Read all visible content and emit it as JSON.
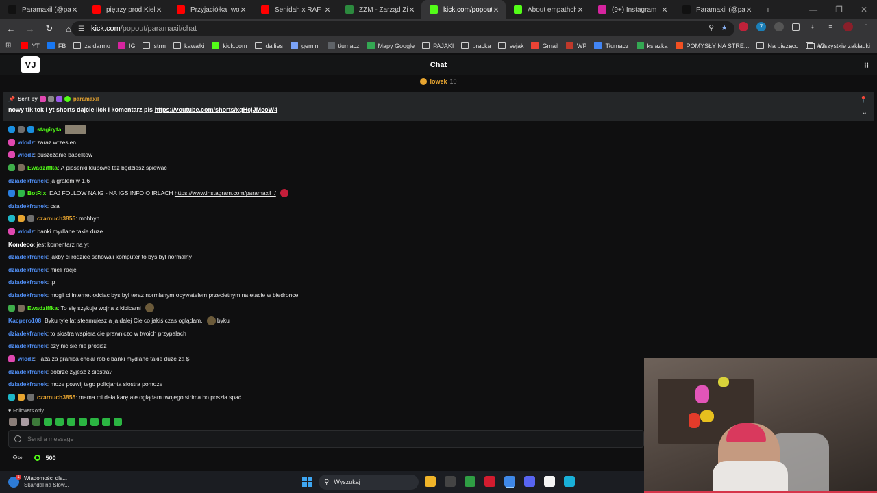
{
  "browser": {
    "tabs": [
      {
        "title": "Paramaxil (@paramaxil)",
        "favicon": "tiktok-icon",
        "color": "#111111"
      },
      {
        "title": "piętrzy prod.Kiełas - YouTube",
        "favicon": "youtube-icon",
        "color": "#ff0000"
      },
      {
        "title": "Przyjaciółka Iwony W",
        "favicon": "youtube-icon",
        "color": "#ff0000"
      },
      {
        "title": "Senidah x RAF Camora",
        "favicon": "youtube-icon",
        "color": "#ff0000"
      },
      {
        "title": "ZZM - Zarząd Zieleni",
        "favicon": "zzm-icon",
        "color": "#2c8a3e"
      },
      {
        "title": "kick.com/popout/paramaxil/chat",
        "favicon": "kick-icon",
        "color": "#53fc18",
        "active": true
      },
      {
        "title": "About empathchan -",
        "favicon": "kick-icon",
        "color": "#53fc18"
      },
      {
        "title": "(9+) Instagram",
        "favicon": "instagram-icon",
        "color": "#d6249f"
      },
      {
        "title": "Paramaxil (@paramaxil)",
        "favicon": "tiktok-icon",
        "color": "#111111"
      }
    ],
    "url_host": "kick.com",
    "url_path": "/popout/paramaxil/chat",
    "bookmarks": [
      {
        "label": "YT",
        "icon": "youtube-icon",
        "color": "#ff0000"
      },
      {
        "label": "FB",
        "icon": "facebook-icon",
        "color": "#1877f2"
      },
      {
        "label": "za darmo",
        "icon": "folder-icon"
      },
      {
        "label": "IG",
        "icon": "instagram-icon",
        "color": "#d6249f"
      },
      {
        "label": "strm",
        "icon": "folder-icon"
      },
      {
        "label": "kawałki",
        "icon": "folder-icon"
      },
      {
        "label": "kick.com",
        "icon": "kick-icon",
        "color": "#53fc18"
      },
      {
        "label": "dailies",
        "icon": "folder-icon"
      },
      {
        "label": "gemini",
        "icon": "gemini-icon",
        "color": "#7aa2f7"
      },
      {
        "label": "tłumacz",
        "icon": "translate-icon",
        "color": "#5f6368"
      },
      {
        "label": "Mapy Google",
        "icon": "maps-icon",
        "color": "#34a853"
      },
      {
        "label": "PAJĄKI",
        "icon": "folder-icon"
      },
      {
        "label": "pracka",
        "icon": "folder-icon"
      },
      {
        "label": "sejak",
        "icon": "folder-icon"
      },
      {
        "label": "Gmail",
        "icon": "gmail-icon",
        "color": "#ea4335"
      },
      {
        "label": "WP",
        "icon": "wp-icon",
        "color": "#c0392b"
      },
      {
        "label": "Tłumacz",
        "icon": "translate-icon",
        "color": "#4285f4"
      },
      {
        "label": "ksiazka",
        "icon": "book-icon",
        "color": "#34a853"
      },
      {
        "label": "POMYSŁY NA STRE...",
        "icon": "windows-icon",
        "color": "#f25022"
      },
      {
        "label": "Na bieżąco",
        "icon": "folder-icon"
      },
      {
        "label": "AD",
        "icon": "folder-icon"
      }
    ],
    "bookmarks_all": "Wszystkie zakładki",
    "more_bookmarks": "»"
  },
  "chat": {
    "header_title": "Chat",
    "logo_text": "VJ",
    "gift": {
      "name": "lowek",
      "count": "10"
    },
    "pinned": {
      "sent_by_label": "Sent by",
      "sender": "paramaxil",
      "message": "nowy tik tok i yt shorts dajcie lick i komentarz pls ",
      "link": "https://youtube.com/shorts/xqHcjJMeoW4"
    },
    "messages": [
      {
        "user": "stagiryta",
        "color": "#53fc18",
        "text": "",
        "badges": [
          "#1a8fe0",
          "#6f6f6f",
          "#1a8fe0"
        ],
        "emote": "wide"
      },
      {
        "user": "wlodz",
        "color": "#4f8cf0",
        "text": "zaraz wrzesien",
        "badges": [
          "#e048b0"
        ]
      },
      {
        "user": "wlodz",
        "color": "#4f8cf0",
        "text": "puszczanie babelkow",
        "badges": [
          "#e048b0"
        ]
      },
      {
        "user": "Ewadziffka",
        "color": "#53fc18",
        "text": "A piosenki klubowe też będziesz śpiewać",
        "badges": [
          "#3fae4a",
          "#7d6d5b"
        ]
      },
      {
        "user": "dziadekfranek",
        "color": "#4f8cf0",
        "text": "ja gralem w 1.6",
        "badges": []
      },
      {
        "user": "BotRix",
        "color": "#53fc18",
        "text": "DAJ FOLLOW NA IG - NA IGS INFO O IRLACH ",
        "link": "https://www.instagram.com/paramaxil_/",
        "badges": [
          "#2a7fe0",
          "#2fb84a"
        ],
        "emote": "red"
      },
      {
        "user": "dziadekfranek",
        "color": "#4f8cf0",
        "text": "csa",
        "badges": []
      },
      {
        "user": "czarnuch3855",
        "color": "#e8a530",
        "text": "mobbyn",
        "badges": [
          "#1fb8c8",
          "#e8a530",
          "#6f6f6f"
        ]
      },
      {
        "user": "wlodz",
        "color": "#4f8cf0",
        "text": "banki mydlane takie duze",
        "badges": [
          "#e048b0"
        ]
      },
      {
        "user": "Kondeoo",
        "color": "#ffffff",
        "text": "jest komentarz na yt",
        "badges": []
      },
      {
        "user": "dziadekfranek",
        "color": "#4f8cf0",
        "text": "jakby ci rodzice schowali komputer to bys byl normalny",
        "badges": []
      },
      {
        "user": "dziadekfranek",
        "color": "#4f8cf0",
        "text": "mieli racje",
        "badges": []
      },
      {
        "user": "dziadekfranek",
        "color": "#4f8cf0",
        "text": ";p",
        "badges": []
      },
      {
        "user": "dziadekfranek",
        "color": "#4f8cf0",
        "text": "mogli ci internet odciac bys byl teraz normlanym obywatelem przecietnym na etacie w biedronce",
        "badges": []
      },
      {
        "user": "Ewadziffka",
        "color": "#53fc18",
        "text": "To się szykuje wojna z kibicami",
        "badges": [
          "#3fae4a",
          "#7d6d5b"
        ],
        "emote": "round"
      },
      {
        "user": "Kacpero108",
        "color": "#4f8cf0",
        "text": "Byku tyle lat steamujesz a ja dalej Cie co jakiś czas oglądam,",
        "text_after": " byku",
        "badges": [],
        "emote": "round"
      },
      {
        "user": "dziadekfranek",
        "color": "#4f8cf0",
        "text": "to siostra wspiera cie prawniczo w twoich przypalach",
        "badges": []
      },
      {
        "user": "dziadekfranek",
        "color": "#4f8cf0",
        "text": "czy nic sie nie prosisz",
        "badges": []
      },
      {
        "user": "wlodz",
        "color": "#4f8cf0",
        "text": "Faza za granica chcial robic banki mydlane takie duze za $",
        "badges": [
          "#e048b0"
        ]
      },
      {
        "user": "dziadekfranek",
        "color": "#4f8cf0",
        "text": "dobrze zyjesz z siostra?",
        "badges": []
      },
      {
        "user": "dziadekfranek",
        "color": "#4f8cf0",
        "text": "moze pozwij tego policjanta siostra pomoze",
        "badges": []
      },
      {
        "user": "czarnuch3855",
        "color": "#e8a530",
        "text": "mama mi dała karę ale oglądam twojego strima bo poszła spać",
        "badges": [
          "#1fb8c8",
          "#e8a530",
          "#6f6f6f"
        ]
      }
    ],
    "followers_only": "Followers only",
    "emote_colors": [
      "#8a7d78",
      "#a89aa0",
      "#3d7a3a",
      "#2bb542",
      "#2bb542",
      "#2bb542",
      "#2bb542",
      "#2bb542",
      "#2bb542",
      "#2bb542"
    ],
    "input_placeholder": "Send a message",
    "points": "500"
  },
  "taskbar": {
    "news_title": "Wiadomości dla...",
    "news_sub": "Skandal na Słow...",
    "news_badge": "1",
    "search_label": "Wyszukaj",
    "apps": [
      {
        "name": "file-explorer-icon",
        "color": "#f0b429"
      },
      {
        "name": "obs-icon",
        "color": "#444444"
      },
      {
        "name": "vpn-icon",
        "color": "#2f9e44"
      },
      {
        "name": "opera-icon",
        "color": "#d31c2f"
      },
      {
        "name": "chrome-icon",
        "color": "#3f88e8",
        "active": true
      },
      {
        "name": "discord-icon",
        "color": "#5865f2"
      },
      {
        "name": "capcut-icon",
        "color": "#f5f5f5"
      },
      {
        "name": "messenger-icon",
        "color": "#19b0d8"
      }
    ]
  }
}
